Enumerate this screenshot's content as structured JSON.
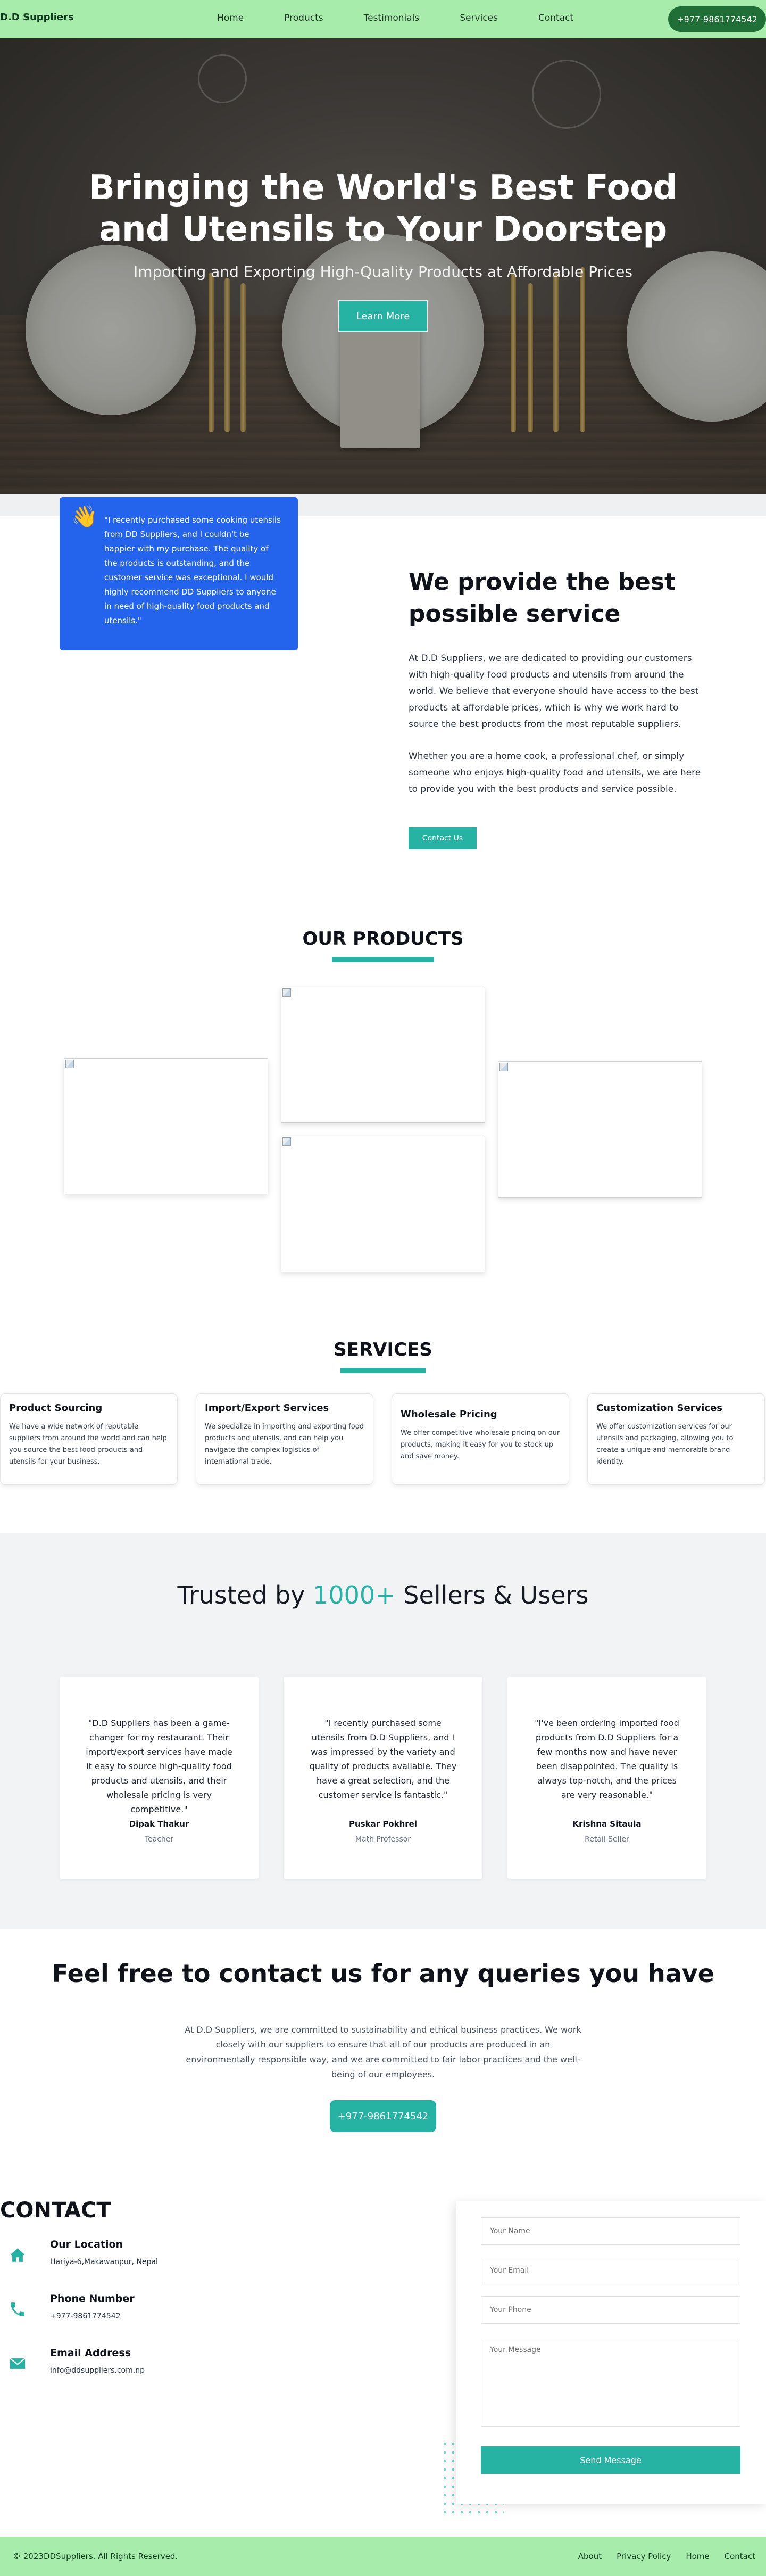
{
  "nav": {
    "brand": "D.D Suppliers",
    "links": [
      "Home",
      "Products",
      "Testimonials",
      "Services",
      "Contact"
    ],
    "phone": "+977-9861774542"
  },
  "hero": {
    "title": "Bringing the World's Best Food and Utensils to Your Doorstep",
    "subtitle": "Importing and Exporting High-Quality Products at Affordable Prices",
    "button": "Learn More"
  },
  "about": {
    "quote": "\"I recently purchased some cooking utensils from DD Suppliers, and I couldn't be happier with my purchase. The quality of the products is outstanding, and the customer service was exceptional. I would highly recommend DD Suppliers to anyone in need of high-quality food products and utensils.\"",
    "title": "We provide the best possible service",
    "paragraph1": "At D.D Suppliers, we are dedicated to providing our customers with high-quality food products and utensils from around the world. We believe that everyone should have access to the best products at affordable prices, which is why we work hard to source the best products from the most reputable suppliers.",
    "paragraph2": "Whether you are a home cook, a professional chef, or simply someone who enjoys high-quality food and utensils, we are here to provide you with the best products and service possible.",
    "button": "Contact Us"
  },
  "products": {
    "title": "OUR PRODUCTS"
  },
  "services": {
    "title": "SERVICES",
    "items": [
      {
        "title": "Product Sourcing",
        "text": "We have a wide network of reputable suppliers from around the world and can help you source the best food products and utensils for your business."
      },
      {
        "title": "Import/Export Services",
        "text": "We specialize in importing and exporting food products and utensils, and can help you navigate the complex logistics of international trade."
      },
      {
        "title": "Wholesale Pricing",
        "text": "We offer competitive wholesale pricing on our products, making it easy for you to stock up and save money."
      },
      {
        "title": "Customization Services",
        "text": "We offer customization services for our utensils and packaging, allowing you to create a unique and memorable brand identity."
      }
    ]
  },
  "trusted": {
    "title_prefix": "Trusted by ",
    "title_accent": "1000+",
    "title_suffix": " Sellers & Users",
    "testimonials": [
      {
        "quote": "\"D.D Suppliers has been a game-changer for my restaurant. Their import/export services have made it easy to source high-quality food products and utensils, and their wholesale pricing is very competitive.\"",
        "name": "Dipak Thakur",
        "role": "Teacher"
      },
      {
        "quote": "\"I recently purchased some utensils from D.D Suppliers, and I was impressed by the variety and quality of products available. They have a great selection, and the customer service is fantastic.\"",
        "name": "Puskar Pokhrel",
        "role": "Math Professor"
      },
      {
        "quote": "\"I've been ordering imported food products from D.D Suppliers for a few months now and have never been disappointed. The quality is always top-notch, and the prices are very reasonable.\"",
        "name": "Krishna Sitaula",
        "role": "Retail Seller"
      }
    ]
  },
  "cta": {
    "title": "Feel free to contact us for any queries you have",
    "paragraph": "At D.D Suppliers, we are committed to sustainability and ethical business practices. We work closely with our suppliers to ensure that all of our products are produced in an environmentally responsible way, and we are committed to fair labor practices and the well-being of our employees.",
    "button": "+977-9861774542"
  },
  "contact": {
    "title": "CONTACT",
    "location_label": "Our Location",
    "location_value": "Hariya-6,Makawanpur, Nepal",
    "phone_label": "Phone Number",
    "phone_value": "+977-9861774542",
    "email_label": "Email Address",
    "email_value": "info@ddsuppliers.com.np",
    "form": {
      "name_placeholder": "Your Name",
      "email_placeholder": "Your Email",
      "phone_placeholder": "Your Phone",
      "message_placeholder": "Your Message",
      "send": "Send Message"
    }
  },
  "footer": {
    "copyright": "© 2023DDSuppliers. All Rights Reserved.",
    "links": [
      "About",
      "Privacy Policy",
      "Home",
      "Contact"
    ]
  },
  "colors": {
    "nav_bg": "#a7ecab",
    "accent": "#27b3a4",
    "quote_card": "#2463eb",
    "phone_pill": "#1f6f36"
  }
}
